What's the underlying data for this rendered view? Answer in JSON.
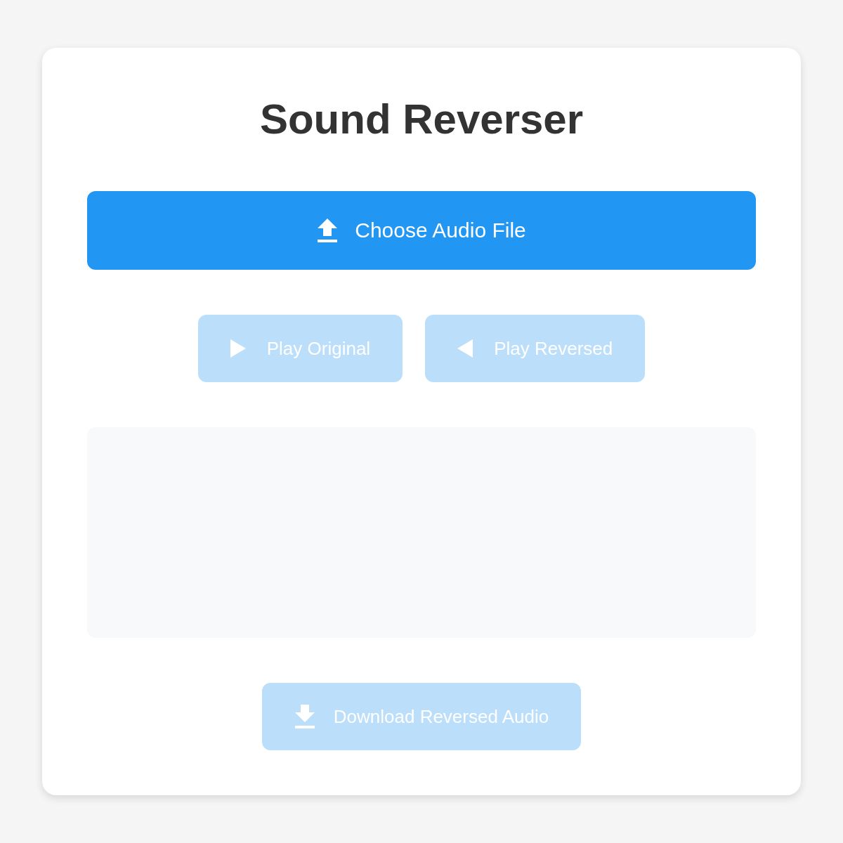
{
  "title": "Sound Reverser",
  "upload_button": {
    "label": "Choose Audio File",
    "disabled": false
  },
  "playback_buttons": [
    {
      "kind": "forward",
      "label": "Play Original",
      "disabled": true
    },
    {
      "kind": "reverse",
      "label": "Play Reversed",
      "disabled": true
    }
  ],
  "download_button": {
    "label": "Download Reversed Audio",
    "disabled": true
  }
}
